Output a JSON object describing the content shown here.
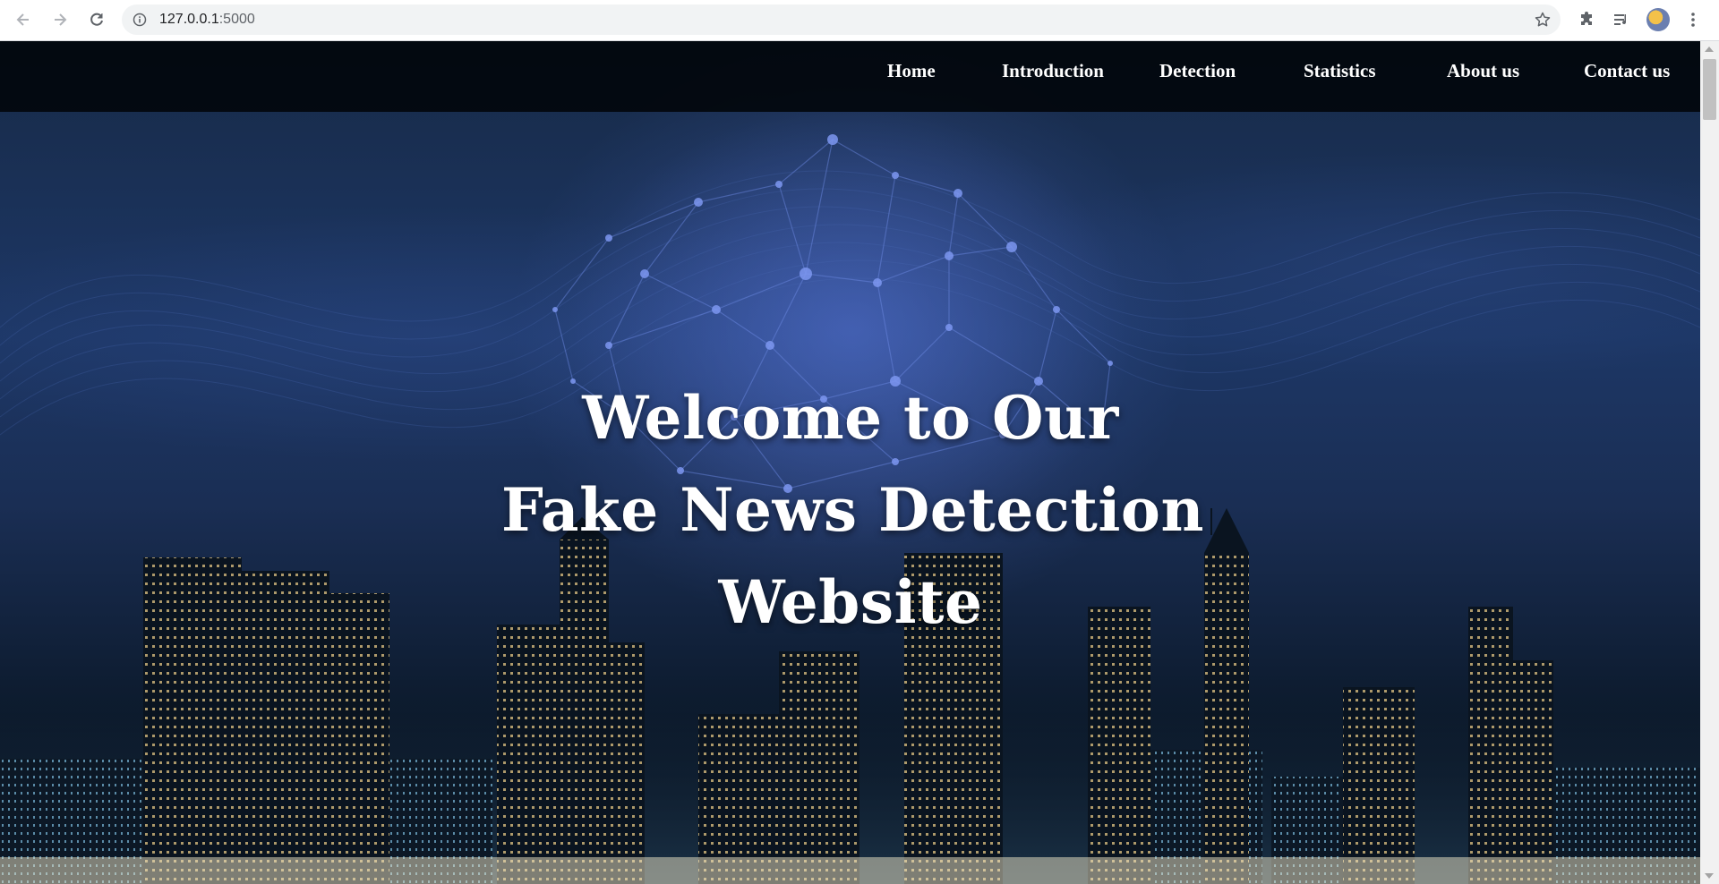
{
  "browser": {
    "url_host": "127.0.0.1",
    "url_port": ":5000",
    "icons": [
      "back-arrow-icon",
      "forward-arrow-icon",
      "reload-icon",
      "site-info-icon",
      "bookmark-star-icon",
      "extensions-icon",
      "reading-list-icon",
      "profile-avatar",
      "more-menu-icon"
    ]
  },
  "nav": {
    "items": [
      {
        "label": "Home"
      },
      {
        "label": "Introduction"
      },
      {
        "label": "Detection"
      },
      {
        "label": "Statistics"
      },
      {
        "label": "About us"
      },
      {
        "label": "Contact us"
      }
    ]
  },
  "hero": {
    "line1": "Welcome to Our",
    "line2": "Fake News Detection",
    "line3": "Website"
  },
  "colors": {
    "nav_bg": "#02060c",
    "text": "#ffffff",
    "sky_top": "#172a47",
    "sky_mid": "#1d3766"
  }
}
